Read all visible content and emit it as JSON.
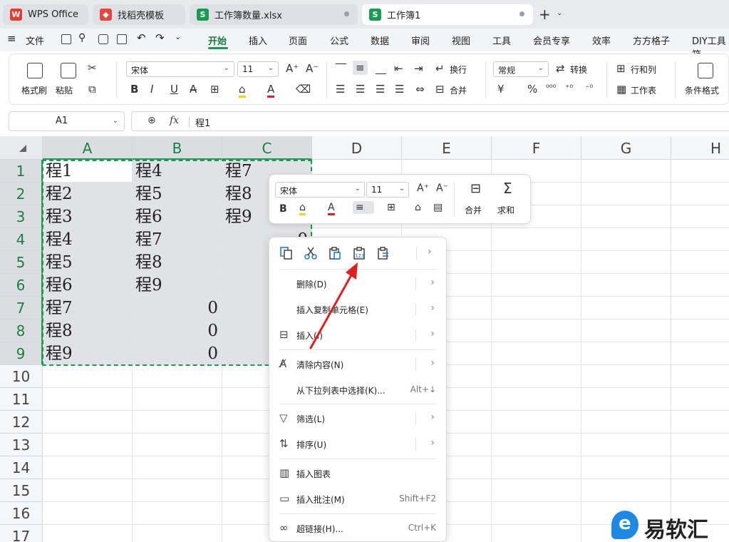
{
  "tabs": [
    {
      "label": "WPS Office",
      "icon": "wps-logo-icon"
    },
    {
      "label": "找稻壳模板",
      "icon": "docer-icon"
    },
    {
      "label": "工作簿数量.xlsx",
      "icon": "spreadsheet-icon"
    },
    {
      "label": "工作簿1",
      "icon": "spreadsheet-icon"
    }
  ],
  "menubar": {
    "file": "文件",
    "items": [
      "开始",
      "插入",
      "页面",
      "公式",
      "数据",
      "审阅",
      "视图",
      "工具",
      "会员专享",
      "效率",
      "方方格子",
      "DIY工具箱"
    ],
    "active": "开始"
  },
  "ribbon": {
    "format_painter": "格式刷",
    "paste": "粘贴",
    "font_name": "宋体",
    "font_size": "11",
    "wrap": "换行",
    "merge": "合并",
    "number_format": "常规",
    "convert": "转换",
    "row_col": "行和列",
    "worksheet": "工作表",
    "conditional_format": "条件格式",
    "currency_symbol": "¥",
    "percent_symbol": "%"
  },
  "formula_bar": {
    "name_box": "A1",
    "fx": "fx",
    "value": "程1"
  },
  "columns": [
    "A",
    "B",
    "C",
    "D",
    "E",
    "F",
    "G",
    "H"
  ],
  "rows": [
    "1",
    "2",
    "3",
    "4",
    "5",
    "6",
    "7",
    "8",
    "9",
    "10",
    "11",
    "12",
    "13",
    "14",
    "15",
    "16",
    "17"
  ],
  "cells": {
    "A": [
      "程1",
      "程2",
      "程3",
      "程4",
      "程5",
      "程6",
      "程7",
      "程8",
      "程9"
    ],
    "B": [
      "程4",
      "程5",
      "程6",
      "程7",
      "程8",
      "程9",
      "0",
      "0",
      "0"
    ],
    "C": [
      "程7",
      "程8",
      "程9",
      "0",
      "",
      "",
      "",
      "",
      ""
    ]
  },
  "mini_toolbar": {
    "font_name": "宋体",
    "font_size": "11",
    "merge": "合并",
    "sum": "求和"
  },
  "context_menu": {
    "items": [
      {
        "label": "删除(D)",
        "has_submenu": true,
        "icon": ""
      },
      {
        "label": "插入复制单元格(E)",
        "has_submenu": true,
        "icon": ""
      },
      {
        "label": "插入(I)",
        "has_submenu": true,
        "icon": "insert-rows-icon"
      },
      {
        "label": "清除内容(N)",
        "has_submenu": true,
        "icon": "clear-content-icon"
      },
      {
        "label": "从下拉列表中选择(K)...",
        "shortcut": "Alt+↓",
        "icon": ""
      },
      {
        "label": "筛选(L)",
        "has_submenu": true,
        "icon": "filter-icon"
      },
      {
        "label": "排序(U)",
        "has_submenu": true,
        "icon": "sort-icon"
      },
      {
        "label": "插入图表",
        "icon": "chart-icon"
      },
      {
        "label": "插入批注(M)",
        "shortcut": "Shift+F2",
        "icon": "comment-icon"
      },
      {
        "label": "超链接(H)...",
        "shortcut": "Ctrl+K",
        "icon": "link-icon"
      }
    ]
  },
  "watermark": {
    "text": "易软汇"
  },
  "colors": {
    "accent_green": "#1a9b53",
    "selection_gray": "#e1e2e5",
    "annotation_red": "#e02020"
  }
}
